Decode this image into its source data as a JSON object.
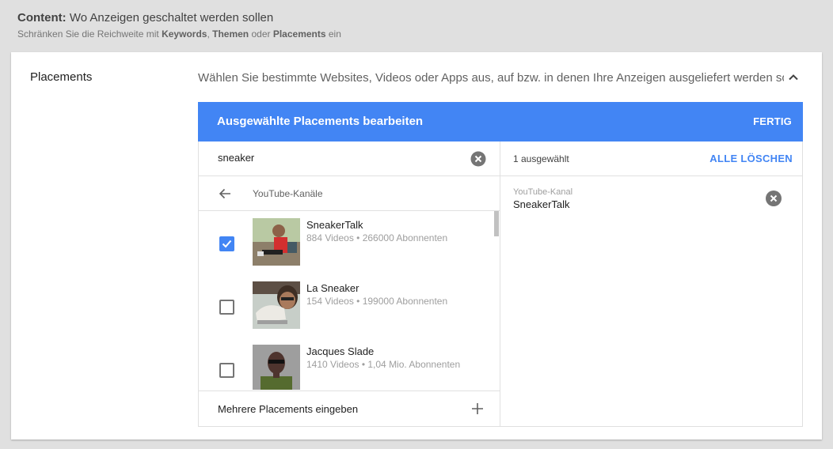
{
  "header": {
    "title_bold": "Content:",
    "title_rest": " Wo Anzeigen geschaltet werden sollen",
    "sub_prefix": "Schränken Sie die Reichweite mit ",
    "sub_kw": "Keywords",
    "sub_sep": ", ",
    "sub_themes": "Themen",
    "sub_or": " oder ",
    "sub_placements": "Placements",
    "sub_suffix": " ein"
  },
  "section": {
    "label": "Placements",
    "description": "Wählen Sie bestimmte Websites, Videos oder Apps aus, auf bzw. in denen Ihre Anzeigen ausgeliefert werden sol"
  },
  "editor": {
    "title": "Ausgewählte Placements bearbeiten",
    "done_label": "FERTIG",
    "search_value": "sneaker",
    "category_label": "YouTube-Kanäle",
    "results": [
      {
        "name": "SneakerTalk",
        "meta": "884 Videos • 266000 Abonnenten",
        "checked": true
      },
      {
        "name": "La Sneaker",
        "meta": "154 Videos • 199000 Abonnenten",
        "checked": false
      },
      {
        "name": "Jacques Slade",
        "meta": "1410 Videos • 1,04 Mio. Abonnenten",
        "checked": false
      }
    ],
    "multi_label": "Mehrere Placements eingeben",
    "selected_count": "1 ausgewählt",
    "clear_all_label": "ALLE LÖSCHEN",
    "selected": [
      {
        "type": "YouTube-Kanal",
        "name": "SneakerTalk"
      }
    ]
  },
  "colors": {
    "accent": "#4285f4",
    "background": "#e0e0e0"
  }
}
